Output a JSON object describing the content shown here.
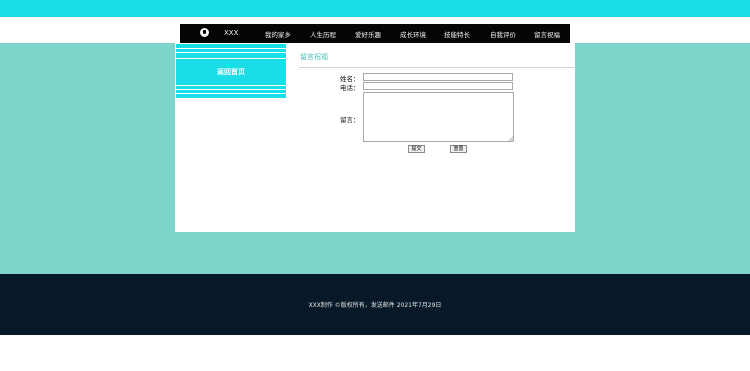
{
  "header": {
    "brand": "XXX",
    "nav": [
      {
        "label": "我的家乡"
      },
      {
        "label": "人生历程"
      },
      {
        "label": "爱好乐趣"
      },
      {
        "label": "成长环境"
      },
      {
        "label": "技能特长"
      },
      {
        "label": "自我评价"
      },
      {
        "label": "留言祝福"
      }
    ],
    "logo_icon": "shield-icon"
  },
  "sidebar": {
    "home_link": "返回首页"
  },
  "main": {
    "section_title": "留言祝福",
    "form": {
      "name_label": "姓名：",
      "name_value": "",
      "phone_label": "电话：",
      "phone_value": "",
      "message_label": "留言：",
      "message_value": "",
      "submit_label": "提交",
      "reset_label": "重置"
    }
  },
  "footer": {
    "text": "XXX制作 ©版权所有，发送邮件 2021年7月29日"
  },
  "colors": {
    "top_strip": "#1adde8",
    "page_band": "#7dd5cb",
    "navbar": "#050505",
    "sidebar_block": "#1adde8",
    "section_title": "#48bfb6",
    "footer": "#071829"
  }
}
